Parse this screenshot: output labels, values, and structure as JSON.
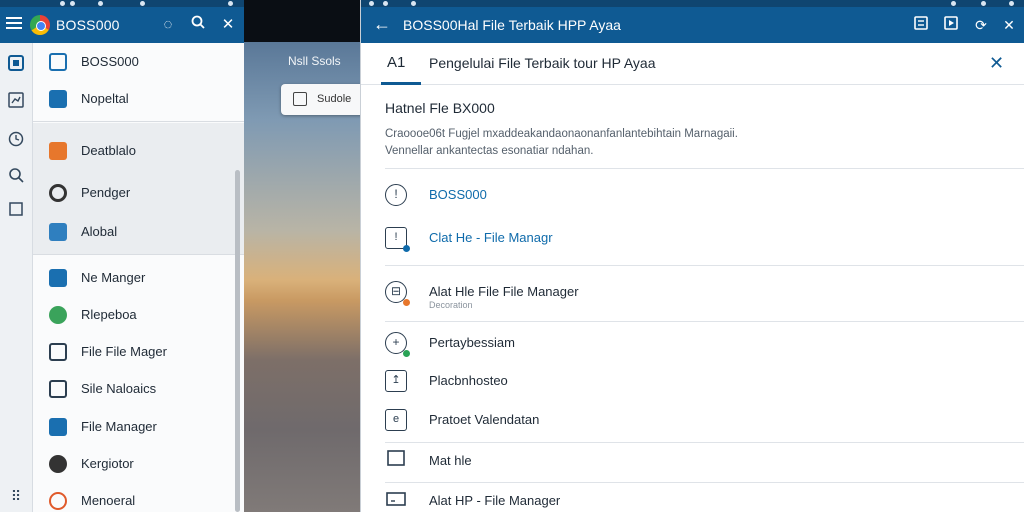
{
  "left": {
    "app_title": "BOSS000",
    "list": [
      {
        "label": "BOSS000",
        "color": "#1a6fb0"
      },
      {
        "label": "Nopeltal",
        "color": "#1a6fb0"
      },
      {
        "label": "Deatblalo",
        "color": "#e7772c"
      },
      {
        "label": "Pendger",
        "color": "#333333"
      },
      {
        "label": "Alobal",
        "color": "#1a6fb0"
      },
      {
        "label": "Ne Manger",
        "color": "#1a6fb0"
      },
      {
        "label": "Rlepeboa",
        "color": "#3aa35b"
      },
      {
        "label": "File File Mager",
        "color": "#2c3e50"
      },
      {
        "label": "Sile Naloaics",
        "color": "#2c3e50"
      },
      {
        "label": "File Manager",
        "color": "#1a6fb0"
      },
      {
        "label": "Kergiotor",
        "color": "#333333"
      },
      {
        "label": "Menoeral",
        "color": "#e05a2b"
      }
    ]
  },
  "wallpaper": {
    "title": "Nsll Ssols",
    "pill_label": "Sudole"
  },
  "right": {
    "window_title": "BOSS00Hal File Terbaik HPP Ayaa",
    "tab_label": "A1",
    "header_title": "Pengelulai File Terbaik tour HP Ayaa",
    "info_title": "Hatnel Fle BX000",
    "info_desc_1": "Craoooe06t Fugjel mxaddeakandaonaonanfanlantebihtain Marnagaii.",
    "info_desc_2": "Vennellar ankantectas esonatiar ndahan.",
    "items": [
      {
        "label": "BOSS000",
        "sub": "",
        "accent": true
      },
      {
        "label": "Clat He - File Managr",
        "sub": "",
        "accent": true
      },
      {
        "label": "Alat Hle File File Manager",
        "sub": "Decoration",
        "accent": false
      },
      {
        "label": "Pertaybessiam",
        "sub": "",
        "accent": false
      },
      {
        "label": "Placbnhosteo",
        "sub": "",
        "accent": false
      },
      {
        "label": "Pratoet Valendatan",
        "sub": "",
        "accent": false
      },
      {
        "label": "Mat hle",
        "sub": "",
        "accent": false
      },
      {
        "label": "Alat HP - File Manager",
        "sub": "",
        "accent": false
      }
    ]
  },
  "colors": {
    "primary": "#0f5a93",
    "accent_text": "#0f6bab",
    "badge_orange": "#e7772c",
    "badge_green": "#2aa356"
  }
}
